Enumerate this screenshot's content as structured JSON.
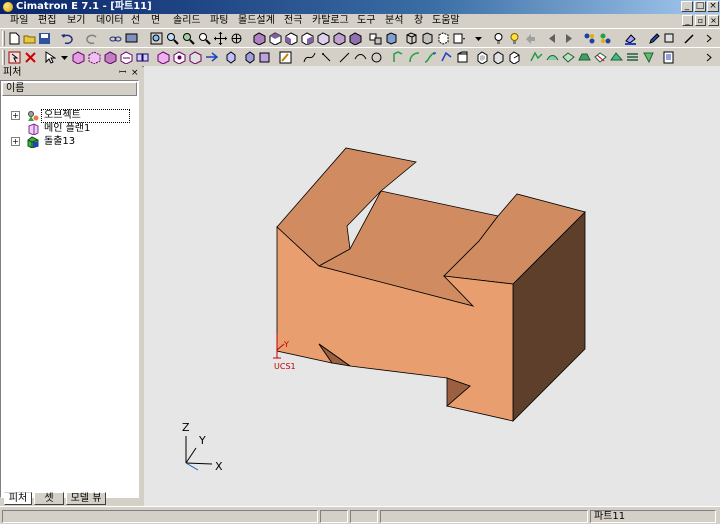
{
  "window": {
    "title": "Cimatron E 7.1 - [파트11]",
    "controls": [
      "_",
      "□",
      "×"
    ]
  },
  "menu": {
    "items": [
      "파일",
      "편집",
      "보기",
      "데이터",
      "선",
      "면",
      "솔리드",
      "파팅",
      "몰드설계",
      "전극",
      "카탈로그",
      "도구",
      "분석",
      "창",
      "도움말"
    ],
    "mdi_controls": [
      "_",
      "▫",
      "×"
    ]
  },
  "panel": {
    "title": "피처",
    "pin_glyph": "ꟷ",
    "close_glyph": "×",
    "column_header": "이름",
    "tree": [
      {
        "label": "오브젝트",
        "icon": "objects-icon",
        "expander": "+"
      },
      {
        "label": "메인 플랜1",
        "icon": "plane-icon",
        "expander": ""
      },
      {
        "label": "돌출13",
        "icon": "extrude-icon",
        "expander": "+"
      }
    ],
    "tabs": [
      "피처",
      "셋",
      "모델 뷰"
    ]
  },
  "viewport": {
    "background": "#e6e6e6",
    "model_colors": {
      "front": "#e89e6e",
      "top": "#d08c60",
      "side": "#5e3f2b",
      "shadow": "#9a6040"
    },
    "ucs_label": "UCS1",
    "ucs_axis_label": "Y",
    "triad": {
      "x": "X",
      "y": "Y",
      "z": "Z"
    }
  },
  "statusbar": {
    "document": "파트11"
  }
}
